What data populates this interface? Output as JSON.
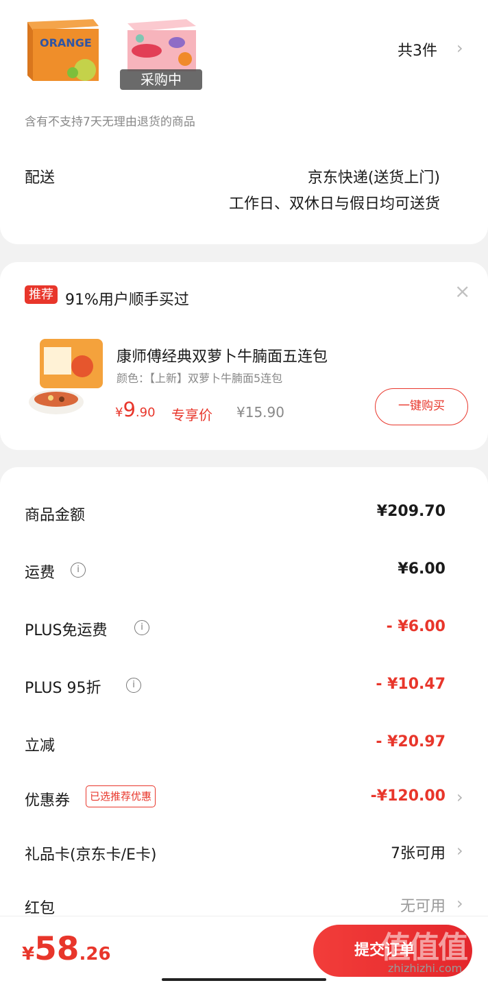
{
  "order_items": {
    "badge": "采购中",
    "count_label": "共3件",
    "return_note": "含有不支持7天无理由退货的商品"
  },
  "delivery": {
    "label": "配送",
    "method": "京东快递(送货上门)",
    "schedule": "工作日、双休日与假日均可送货"
  },
  "recommend": {
    "tag": "推荐",
    "headline": "91%用户顺手买过",
    "product_title": "康师傅经典双萝卜牛腩面五连包",
    "spec": "颜色：【上新】双萝卜牛腩面5连包",
    "price_symbol": "¥",
    "price_int": "9",
    "price_dec": ".90",
    "price_tag": "专享价",
    "original_price": "¥15.90",
    "buy_button": "一键购买"
  },
  "summary": {
    "rows": [
      {
        "label": "商品金额",
        "value": "¥209.70"
      },
      {
        "label": "运费",
        "value": "¥6.00"
      },
      {
        "label": "PLUS免运费",
        "value": "- ¥6.00"
      },
      {
        "label": "PLUS 95折",
        "value": "- ¥10.47"
      },
      {
        "label": "立减",
        "value": "- ¥20.97"
      },
      {
        "label": "优惠券",
        "badge": "已选推荐优惠",
        "value": "-¥120.00"
      },
      {
        "label": "礼品卡(京东卡/E卡)",
        "value": "7张可用"
      },
      {
        "label": "红包",
        "value": "无可用"
      }
    ]
  },
  "footer": {
    "total_symbol": "¥",
    "total_int": "58",
    "total_dec": ".26",
    "submit_label": "提交订单",
    "watermark": "值值值",
    "watermark_url": "zhizhizhi.com"
  },
  "colors": {
    "accent": "#e8362b",
    "background": "#f2f2f2"
  }
}
